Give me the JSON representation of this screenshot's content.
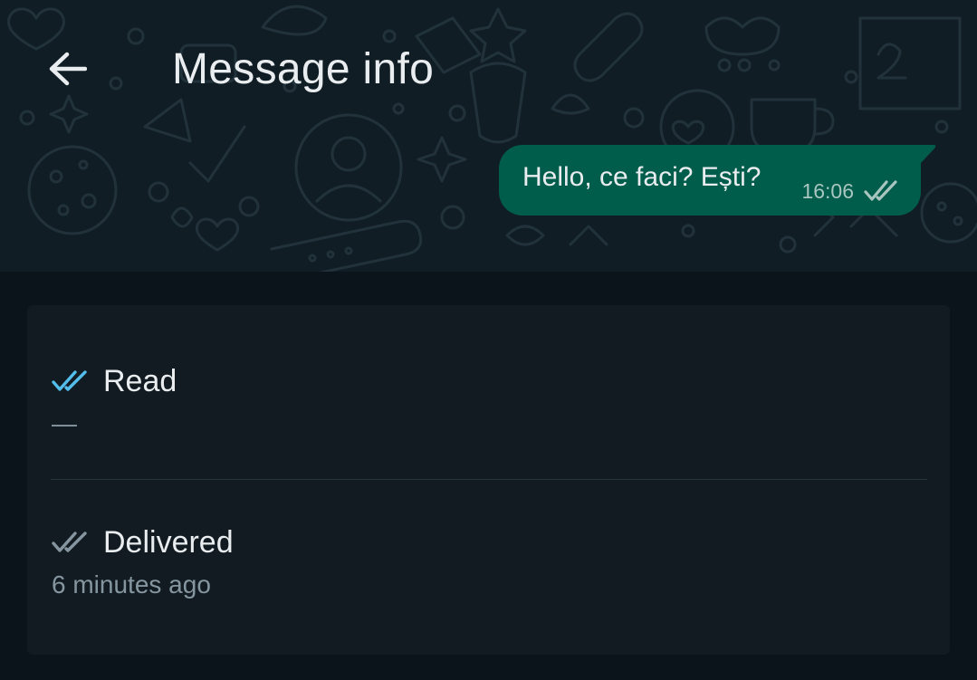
{
  "header": {
    "title": "Message info",
    "back_icon": "arrow-left-icon"
  },
  "message": {
    "text": "Hello, ce faci? Ești?",
    "time": "16:06",
    "status_icon": "double-check-icon"
  },
  "receipts": {
    "read": {
      "label": "Read",
      "value": "—",
      "icon": "double-check-blue-icon"
    },
    "delivered": {
      "label": "Delivered",
      "value": "6 minutes ago",
      "icon": "double-check-gray-icon"
    }
  },
  "colors": {
    "background": "#0b141a",
    "header_bg": "#101d25",
    "bubble": "#005c4b",
    "card": "#111b21",
    "read_check": "#53bdeb",
    "delivered_check": "#8696a0",
    "text_primary": "#e9edef",
    "text_secondary": "#8696a0"
  }
}
